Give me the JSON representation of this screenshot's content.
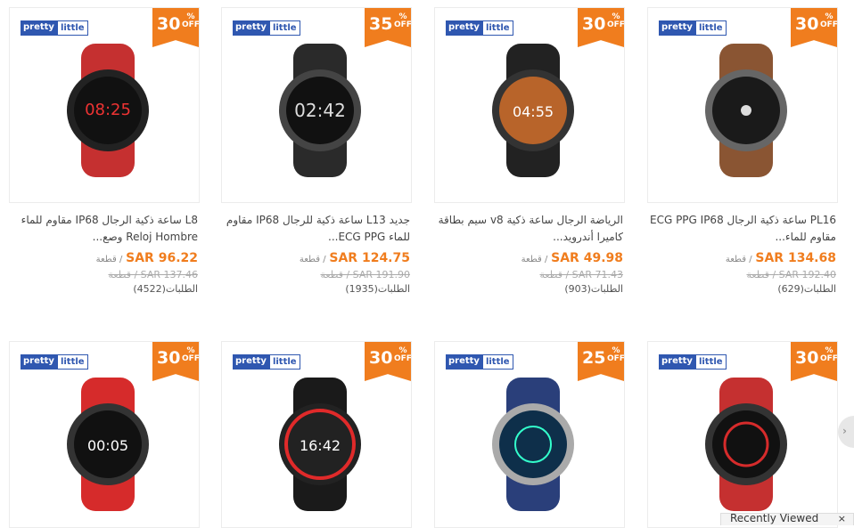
{
  "products": [
    {
      "title": "L8 ساعة ذكية الرجال IP68 مقاوم للماء Reloj Hombre وصع...",
      "price": "SAR 96.22",
      "unit": "/ قطعة",
      "old_price": "SAR 137.46 / قطعة",
      "orders": "الطلبات(4522)",
      "discount": "30",
      "discount_label": "%\nOFF",
      "brand": [
        "pretty",
        "little"
      ],
      "accent": "#d62b2b"
    },
    {
      "title": "جديد L13 ساعة ذكية للرجال IP68 مقاوم للماء ECG PPG...",
      "price": "SAR 124.75",
      "unit": "/ قطعة",
      "old_price": "SAR 191.90 / قطعة",
      "orders": "الطلبات(1935)",
      "discount": "35",
      "discount_label": "%\nOFF",
      "brand": [
        "pretty",
        "little"
      ],
      "accent": "#2fbf4a"
    },
    {
      "title": "الرياضة الرجال ساعة ذكية v8 سيم بطاقة كاميرا أندرويد...",
      "price": "SAR 49.98",
      "unit": "/ قطعة",
      "old_price": "SAR 71.43 / قطعة",
      "orders": "الطلبات(903)",
      "discount": "30",
      "discount_label": "%\nOFF",
      "brand": [
        "pretty",
        "little"
      ],
      "accent": "#e8a040"
    },
    {
      "title": "PL16 ساعة ذكية الرجال ECG PPG IP68 مقاوم للماء...",
      "price": "SAR 134.68",
      "unit": "/ قطعة",
      "old_price": "SAR 192.40 / قطعة",
      "orders": "الطلبات(629)",
      "discount": "30",
      "discount_label": "%\nOFF",
      "brand": [
        "pretty",
        "little"
      ],
      "accent": "#8a5533"
    },
    {
      "discount": "30",
      "discount_label": "%\nOFF",
      "brand": [
        "pretty",
        "little"
      ],
      "accent": "#d62b2b"
    },
    {
      "discount": "30",
      "discount_label": "%\nOFF",
      "brand": [
        "pretty",
        "little"
      ],
      "accent": "#e02a2a"
    },
    {
      "discount": "25",
      "discount_label": "%\nOFF",
      "brand": [
        "pretty",
        "little"
      ],
      "accent": "#2a3f7a"
    },
    {
      "discount": "30",
      "discount_label": "%\nOFF",
      "brand": [
        "pretty",
        "little"
      ],
      "accent": "#d62b2b"
    }
  ],
  "recent": {
    "label": "Recently Viewed",
    "close": "×"
  },
  "nav_arrow": "›",
  "icons": {
    "badge": "discount-badge",
    "watch": "smartwatch-icon"
  }
}
